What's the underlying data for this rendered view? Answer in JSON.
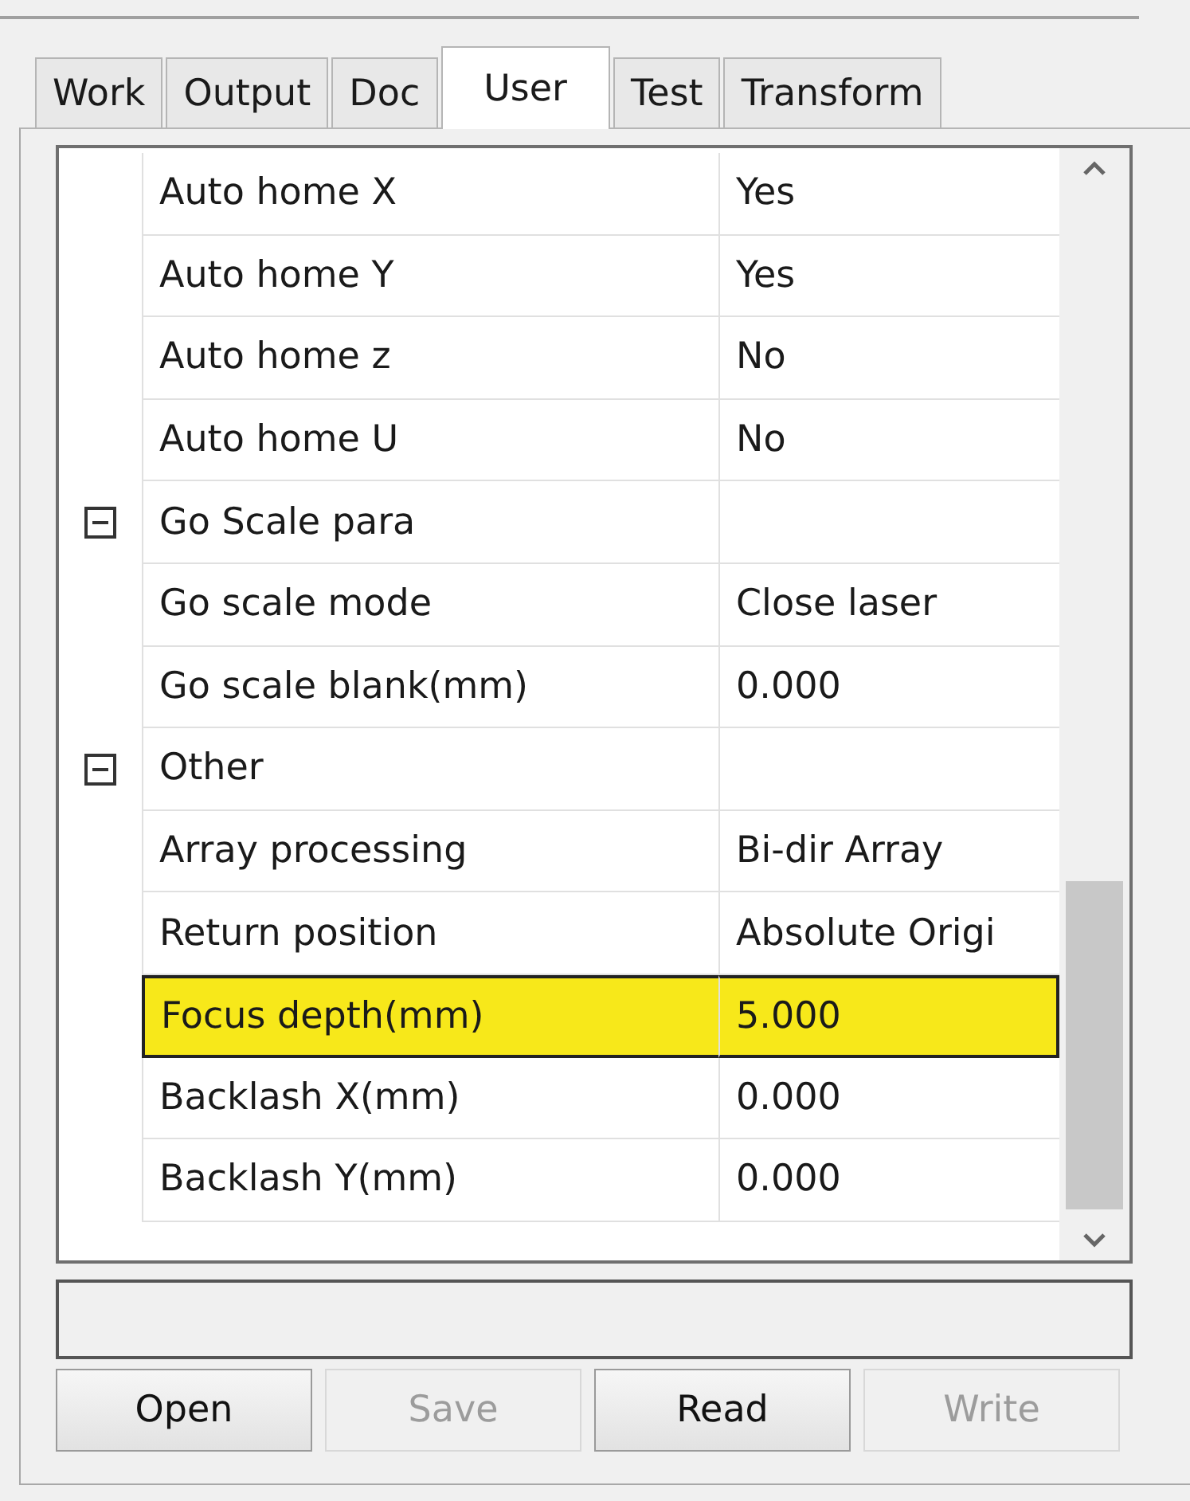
{
  "tabs": [
    {
      "label": "Work",
      "selected": false
    },
    {
      "label": "Output",
      "selected": false
    },
    {
      "label": "Doc",
      "selected": false
    },
    {
      "label": "User",
      "selected": true
    },
    {
      "label": "Test",
      "selected": false
    },
    {
      "label": "Transform",
      "selected": false
    }
  ],
  "properties": [
    {
      "name": "Auto home X",
      "value": "Yes",
      "selected": false
    },
    {
      "name": "Auto home Y",
      "value": "Yes",
      "selected": false
    },
    {
      "name": "Auto home z",
      "value": "No",
      "selected": false
    },
    {
      "name": "Auto home U",
      "value": "No",
      "selected": false
    },
    {
      "name": "Go Scale para",
      "expanded": true,
      "selected": false,
      "children": [
        {
          "name": "Go scale mode",
          "value": "Close laser",
          "selected": false
        },
        {
          "name": "Go scale blank(mm)",
          "value": "0.000",
          "selected": false
        }
      ]
    },
    {
      "name": "Other",
      "expanded": true,
      "selected": false,
      "children": [
        {
          "name": "Array processing",
          "value": "Bi-dir Array",
          "selected": false
        },
        {
          "name": "Return position",
          "value": "Absolute Origi",
          "selected": false
        },
        {
          "name": "Focus depth(mm)",
          "value": "5.000",
          "selected": true
        },
        {
          "name": "Backlash X(mm)",
          "value": "0.000",
          "selected": false
        },
        {
          "name": "Backlash Y(mm)",
          "value": "0.000",
          "selected": false
        }
      ]
    }
  ],
  "buttons": [
    {
      "label": "Open",
      "disabled": false
    },
    {
      "label": "Save",
      "disabled": true
    },
    {
      "label": "Read",
      "disabled": false
    },
    {
      "label": "Write",
      "disabled": true
    }
  ]
}
